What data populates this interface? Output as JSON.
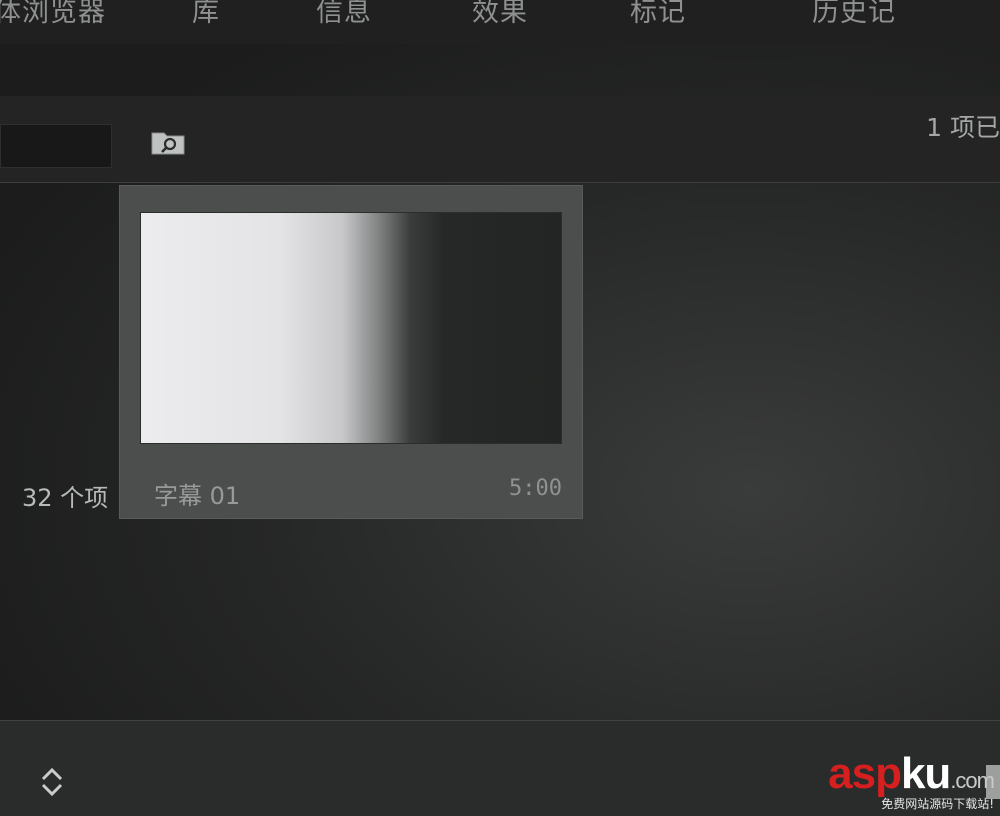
{
  "panel": {
    "tabs": [
      "体浏览器",
      "库",
      "信息",
      "效果",
      "标记",
      "历史记"
    ]
  },
  "toolbar": {
    "search_value": "",
    "item_count": "1 项已"
  },
  "bin": {
    "count_label": "32 个项"
  },
  "clip": {
    "name": "字幕 01",
    "duration": "5:00"
  },
  "icons": {
    "search_in_folder": "folder-search-icon",
    "sort": "sort-updown-icon",
    "trash": "trash-icon"
  },
  "watermark": {
    "logo_a": "asp",
    "logo_b": "ku",
    "logo_c": ".com",
    "slogan": "免费网站源码下载站!"
  }
}
